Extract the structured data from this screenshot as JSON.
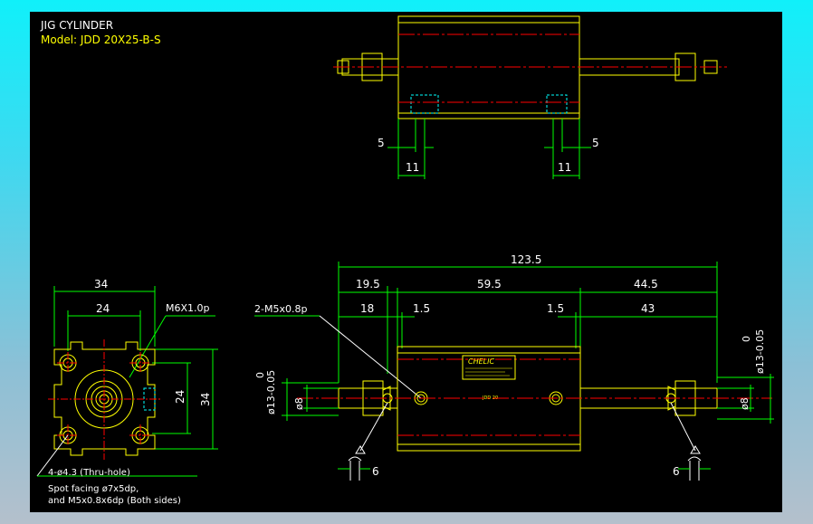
{
  "title": {
    "line1": "JIG CYLINDER",
    "line2": "Model: JDD 20X25-B-S"
  },
  "top_view": {
    "dim_left_offset": "5",
    "dim_right_offset": "5",
    "dim_left_width": "11",
    "dim_right_width": "11"
  },
  "front_view": {
    "overall_length": "123.5",
    "seg_left": "19.5",
    "seg_mid": "59.5",
    "seg_right": "44.5",
    "rod_left": "18",
    "gap_left": "1.5",
    "gap_right": "1.5",
    "rod_right": "43",
    "port_callout": "2-M5x0.8p",
    "tol_left_upper": "0",
    "tol_left_lower": "ø13-0.05",
    "tol_right_upper": "0",
    "tol_right_lower": "ø13-0.05",
    "rod_dia_left": "ø8",
    "rod_dia_right": "ø8",
    "bottom_left_dim": "6",
    "bottom_right_dim": "6",
    "label_brand": "CHELIC",
    "label_text": "JDD 20"
  },
  "end_view": {
    "width_outer": "34",
    "width_inner": "24",
    "thread_callout": "M6X1.0p",
    "height_inner": "24",
    "height_outer": "34",
    "hole_note": "4-ø4.3 (Thru-hole)",
    "spot_note_1": "Spot facing ø7x5dp,",
    "spot_note_2": "and M5x0.8x6dp (Both sides)"
  },
  "colors": {
    "background": "#000000",
    "outline": "#ffff00",
    "dimension": "#00ff00",
    "centerline": "#ff0000",
    "hidden": "#00ffff",
    "text": "#ffffff"
  }
}
